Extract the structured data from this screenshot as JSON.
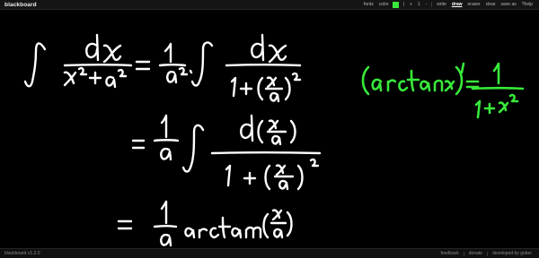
{
  "app": {
    "name": "blackboard",
    "version": "blackboard v1.2.0"
  },
  "toolbar": {
    "fonts_label": "fonts",
    "color_label": "color",
    "pen_color": "#38e83a",
    "stroke_separator": "|",
    "increase_label": "+",
    "stroke_size": "1",
    "decrease_label": "-",
    "write_label": "write",
    "draw_label": "draw",
    "eraser_label": "eraser",
    "clear_label": "clear",
    "save_label": "save as",
    "help_label": "?help"
  },
  "footer": {
    "feedback_label": "feedback",
    "donate_label": "donate",
    "developer_label": "developed by gober"
  },
  "board": {
    "white_ink": "#ffffff",
    "green_ink": "#38e83a"
  }
}
